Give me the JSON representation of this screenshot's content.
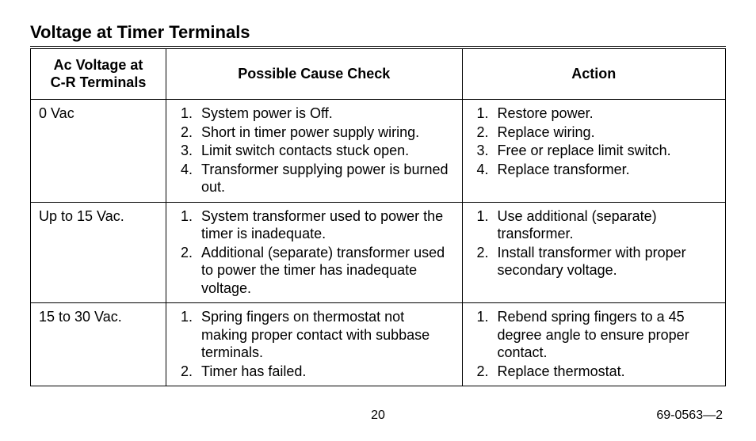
{
  "title": "Voltage at Timer Terminals",
  "headers": {
    "col1a": "Ac Voltage at",
    "col1b": "C-R Terminals",
    "col2": "Possible Cause Check",
    "col3": "Action"
  },
  "rows": [
    {
      "voltage": "0 Vac",
      "causes": [
        "System power is Off.",
        "Short in timer power supply wiring.",
        "Limit switch contacts stuck open.",
        "Transformer supplying power is burned out."
      ],
      "actions": [
        "Restore power.",
        "Replace wiring.",
        "Free or replace limit switch.",
        "Replace transformer."
      ]
    },
    {
      "voltage": "Up to 15 Vac.",
      "causes": [
        "System transformer used to power the timer is inadequate.",
        "Additional (separate) transformer used to power the timer has inadequate voltage."
      ],
      "actions": [
        "Use additional (separate) transformer.",
        "Install transformer with proper secondary voltage."
      ]
    },
    {
      "voltage": "15 to 30 Vac.",
      "causes": [
        "Spring fingers on thermostat not making proper contact with subbase terminals.",
        "Timer has failed."
      ],
      "actions": [
        "Rebend spring fingers to a 45 degree angle to ensure proper contact.",
        "Replace thermostat."
      ]
    }
  ],
  "footer": {
    "page": "20",
    "doc": "69-0563—2"
  }
}
